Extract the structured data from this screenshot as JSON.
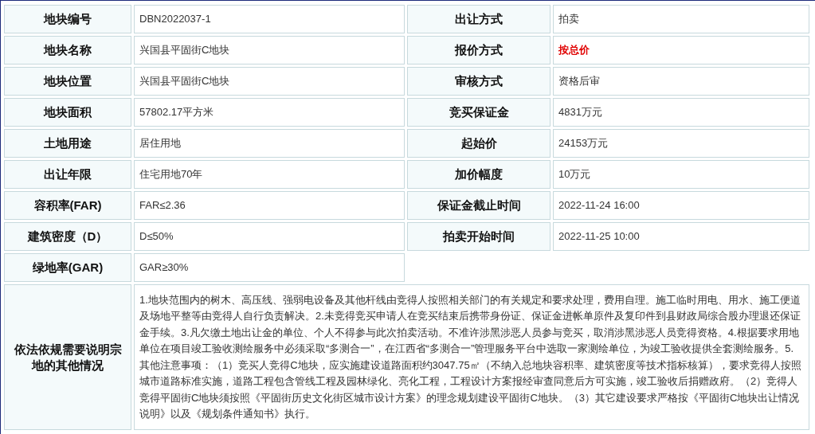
{
  "rows": [
    {
      "cells": [
        {
          "label": "地块编号",
          "value": "DBN2022037-1",
          "highlight": false
        },
        {
          "label": "出让方式",
          "value": "拍卖",
          "highlight": false
        }
      ]
    },
    {
      "cells": [
        {
          "label": "地块名称",
          "value": "兴国县平固街C地块",
          "highlight": false
        },
        {
          "label": "报价方式",
          "value": "按总价",
          "highlight": true
        }
      ]
    },
    {
      "cells": [
        {
          "label": "地块位置",
          "value": "兴国县平固街C地块",
          "highlight": false
        },
        {
          "label": "审核方式",
          "value": "资格后审",
          "highlight": false
        }
      ]
    },
    {
      "cells": [
        {
          "label": "地块面积",
          "value": "57802.17平方米",
          "highlight": false
        },
        {
          "label": "竞买保证金",
          "value": "4831万元",
          "highlight": false
        }
      ]
    },
    {
      "cells": [
        {
          "label": "土地用途",
          "value": "居住用地",
          "highlight": false
        },
        {
          "label": "起始价",
          "value": "24153万元",
          "highlight": false
        }
      ]
    },
    {
      "cells": [
        {
          "label": "出让年限",
          "value": "住宅用地70年",
          "highlight": false
        },
        {
          "label": "加价幅度",
          "value": "10万元",
          "highlight": false
        }
      ]
    },
    {
      "cells": [
        {
          "label": "容积率(FAR)",
          "value": "FAR≤2.36",
          "highlight": false
        },
        {
          "label": "保证金截止时间",
          "value": "2022-11-24 16:00",
          "highlight": false
        }
      ]
    },
    {
      "cells": [
        {
          "label": "建筑密度（D）",
          "value": "D≤50%",
          "highlight": false
        },
        {
          "label": "拍卖开始时间",
          "value": "2022-11-25 10:00",
          "highlight": false
        }
      ]
    },
    {
      "cells": [
        {
          "label": "绿地率(GAR)",
          "value": "GAR≥30%",
          "highlight": false
        }
      ]
    }
  ],
  "notes": {
    "label": "依法依规需要说明宗地的其他情况",
    "text": "1.地块范围内的树木、高压线、强弱电设备及其他杆线由竞得人按照相关部门的有关规定和要求处理，费用自理。施工临时用电、用水、施工便道及场地平整等由竞得人自行负责解决。2.未竞得竞买申请人在竞买结束后携带身份证、保证金进帐单原件及复印件到县财政局综合股办理退还保证金手续。3.凡欠缴土地出让金的单位、个人不得参与此次拍卖活动。不准许涉黑涉恶人员参与竞买，取消涉黑涉恶人员竞得资格。4.根据要求用地单位在项目竣工验收测绘服务中必须采取“多测合一”，在江西省“多测合一”管理服务平台中选取一家测绘单位，为竣工验收提供全套测绘服务。5.其他注意事项：（1）竞买人竞得C地块，应实施建设道路面积约3047.75㎡（不纳入总地块容积率、建筑密度等技术指标核算），要求竞得人按照城市道路标准实施，道路工程包含管线工程及园林绿化、亮化工程，工程设计方案报经审查同意后方可实施，竣工验收后捐赠政府。（2）竞得人竞得平固街C地块须按照《平固街历史文化街区城市设计方案》的理念规划建设平固街C地块。（3）其它建设要求严格按《平固街C地块出让情况说明》以及《规划条件通知书》执行。"
  }
}
